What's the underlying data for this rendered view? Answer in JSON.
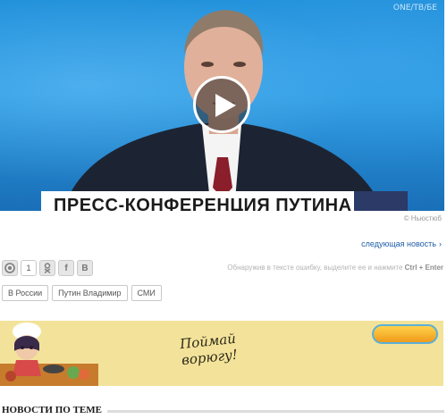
{
  "video": {
    "watermark": "ONE/ТВ/БЕ",
    "banner_text": "ПРЕСС-КОНФЕРЕНЦИЯ ПУТИНА",
    "play_icon": "play-icon"
  },
  "credit": "© Ньюстюб",
  "next_news": {
    "label": "следующая новость",
    "arrow": "›"
  },
  "social": {
    "icons": [
      "share-icon",
      "odnoklassniki-icon",
      "facebook-icon",
      "vk-icon"
    ],
    "share_count": "1",
    "ok_glyph": "ok",
    "fb_glyph": "f",
    "vk_glyph": "В"
  },
  "hint": {
    "text": "Обнаружив в тексте ошибку, выделите ее и нажмите ",
    "keys": "Ctrl + Enter"
  },
  "tags": [
    "В России",
    "Путин Владимир",
    "СМИ"
  ],
  "ad": {
    "slogan_line1": "Поймай",
    "slogan_line2": "ворюгу!"
  },
  "related": {
    "title": "НОВОСТИ ПО ТЕМЕ"
  }
}
